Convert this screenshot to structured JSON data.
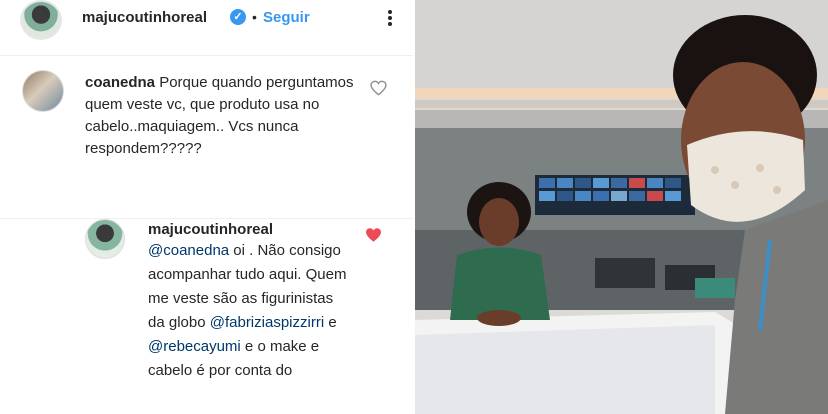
{
  "post_header": {
    "username": "majucoutinhoreal",
    "verified_icon": "verified-badge-icon",
    "separator": "•",
    "follow_label": "Seguir",
    "more_icon": "more-options-icon"
  },
  "comment": {
    "username": "coanedna",
    "text": "Porque quando perguntamos quem veste vc, que produto usa no cabelo..maquiagem.. Vcs nunca respondem?????",
    "like_icon": "heart-outline-icon"
  },
  "reply": {
    "username": "majucoutinhoreal",
    "mention1": "@coanedna",
    "text1": " oi . Não consigo acompanhar tudo aqui. Quem me veste são as figurinistas da globo ",
    "mention2": "@fabriziaspizzirri",
    "text2": " e ",
    "mention3": "@rebecayumi",
    "text3": " e o make e cabelo é por conta do",
    "like_icon": "heart-filled-icon",
    "like_color": "#ed4956"
  },
  "colors": {
    "link_blue": "#3897f0",
    "mention_blue": "#00376b"
  }
}
